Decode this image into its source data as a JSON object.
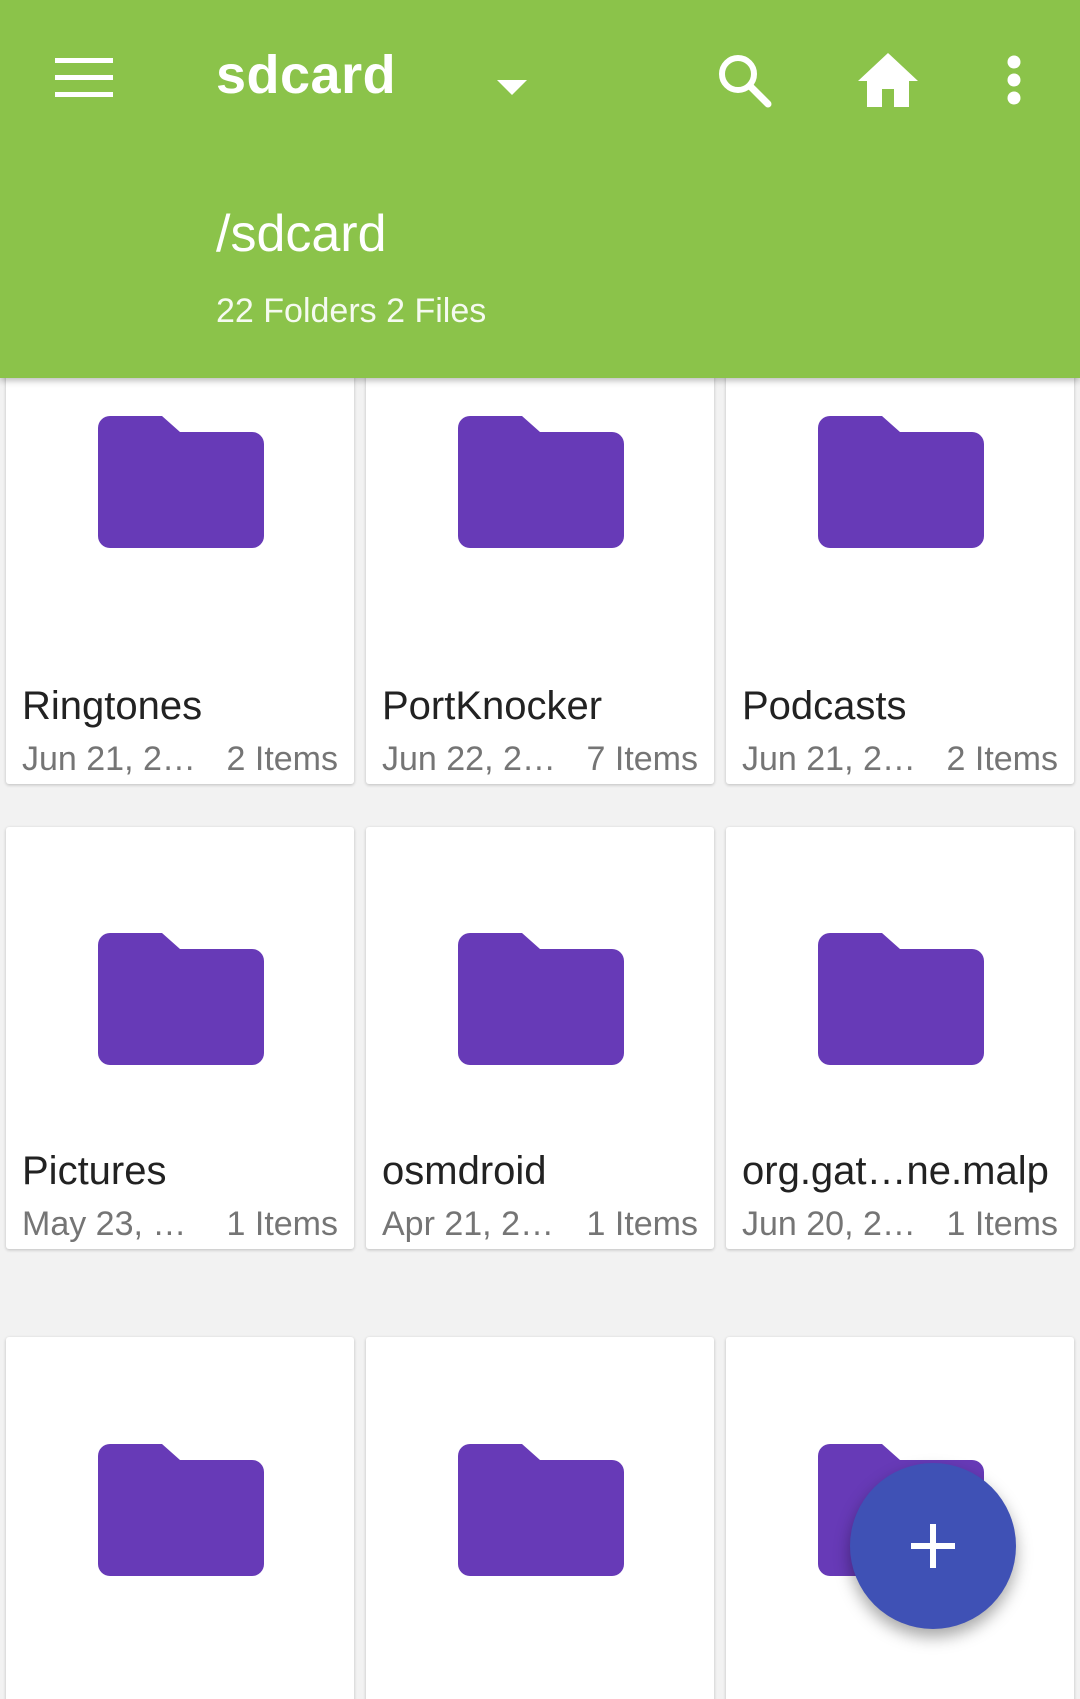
{
  "app_bar": {
    "title": "sdcard",
    "path": "/sdcard",
    "summary": "22 Folders 2 Files",
    "background_color": "#8bc34a",
    "icons": {
      "menu": "menu-icon",
      "dropdown": "dropdown-arrow-icon",
      "search": "search-icon",
      "home": "home-icon",
      "more": "more-vert-icon"
    }
  },
  "folder_color": "#673ab7",
  "folders": [
    {
      "name": "Ringtones",
      "date": "Jun 21, 2…",
      "items": "2 Items"
    },
    {
      "name": "PortKnocker",
      "date": "Jun 22, 2…",
      "items": "7 Items"
    },
    {
      "name": "Podcasts",
      "date": "Jun 21, 2…",
      "items": "2 Items"
    },
    {
      "name": "Pictures",
      "date": "May 23, 2…",
      "items": "1 Items"
    },
    {
      "name": "osmdroid",
      "date": "Apr 21, 2…",
      "items": "1 Items"
    },
    {
      "name": "org.gat…ne.malp",
      "date": "Jun 20, 2…",
      "items": "1 Items"
    },
    {
      "name": "",
      "date": "",
      "items": ""
    },
    {
      "name": "",
      "date": "",
      "items": ""
    },
    {
      "name": "",
      "date": "",
      "items": ""
    }
  ],
  "fab": {
    "icon": "plus-icon",
    "color": "#3f51b5"
  }
}
